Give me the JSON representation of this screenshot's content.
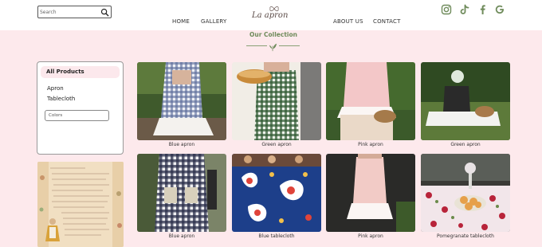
{
  "header": {
    "search_placeholder": "Search",
    "nav": {
      "home": "HOME",
      "gallery": "GALLERY",
      "about": "ABOUT US",
      "contact": "CONTACT"
    },
    "logo_text": "La apron",
    "social_icons": [
      "instagram-icon",
      "tiktok-icon",
      "facebook-icon",
      "google-icon"
    ],
    "accent_color": "#6f8b5b"
  },
  "collection": {
    "title": "Our Collection"
  },
  "sidebar": {
    "all_products": "All Products",
    "items": [
      "Apron",
      "Tablecloth"
    ],
    "colors_placeholder": "Colors"
  },
  "products": [
    {
      "name": "Blue apron"
    },
    {
      "name": "Green apron"
    },
    {
      "name": "Pink apron"
    },
    {
      "name": "Green apron"
    },
    {
      "name": "Blue apron"
    },
    {
      "name": "Blue tablecloth"
    },
    {
      "name": "Pink apron"
    },
    {
      "name": "Pomegranate tablecloth"
    }
  ],
  "colors": {
    "page_bg": "#fde9ec",
    "header_bg": "#ffffff",
    "card_bg": "#ffffff"
  }
}
